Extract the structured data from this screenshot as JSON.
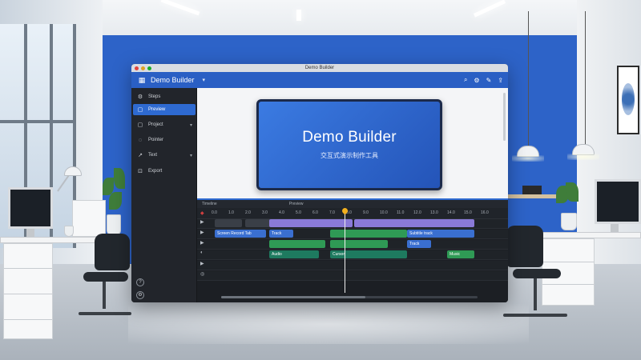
{
  "window": {
    "title": "Demo Builder",
    "traffic_colors": [
      "#e0443e",
      "#dea123",
      "#1aab29"
    ]
  },
  "appbar": {
    "logo_icon": "grid-logo-icon",
    "name": "Demo Builder",
    "menu": "▾",
    "icons": [
      "search-icon",
      "settings-icon",
      "edit-icon",
      "share-icon"
    ],
    "icon_glyphs": [
      "⌕",
      "⚙",
      "✎",
      "⇪"
    ]
  },
  "sidebar": {
    "items": [
      {
        "icon": "gear-icon",
        "glyph": "⚙",
        "label": "Steps",
        "chevron": ""
      },
      {
        "icon": "screen-icon",
        "glyph": "▢",
        "label": "Preview",
        "chevron": "",
        "active": true
      },
      {
        "icon": "layers-icon",
        "glyph": "▢",
        "label": "Project",
        "chevron": "▾"
      },
      {
        "icon": "cursor-icon",
        "glyph": "◌",
        "label": "Pointer",
        "chevron": ""
      },
      {
        "icon": "text-icon",
        "glyph": "↗",
        "label": "Text",
        "chevron": "▾"
      },
      {
        "icon": "export-icon",
        "glyph": "⊡",
        "label": "Export",
        "chevron": ""
      }
    ],
    "bottom_icons": [
      "help-icon",
      "settings-icon"
    ],
    "bottom_glyphs": [
      "?",
      "⚙"
    ]
  },
  "preview": {
    "title": "Demo Builder",
    "subtitle": "交互式演示制作工具"
  },
  "timeline": {
    "tab_left": "Timeline",
    "tab_right": "Preview",
    "ruler_labels": [
      "0.0",
      "1.0",
      "2.0",
      "3.0",
      "4.0",
      "5.0",
      "6.0",
      "7.0",
      "8.0",
      "9.0",
      "10.0",
      "11.0",
      "12.0",
      "13.0",
      "14.0",
      "15.0",
      "16.0"
    ],
    "track_heads": [
      "▶",
      "▶",
      "▶",
      "◐",
      "▶",
      "◎"
    ],
    "clips": {
      "c1": "Screen Record Tab",
      "c2": "Track",
      "c3": "Subtitle track",
      "c4": "Track",
      "c5": "Audio",
      "c6": "Cursor",
      "c7": "Music"
    },
    "colors": {
      "purple": "#8a7ad8",
      "blue": "#3a6fd0",
      "green": "#2f9a55",
      "teal": "#1e7a5f"
    }
  }
}
